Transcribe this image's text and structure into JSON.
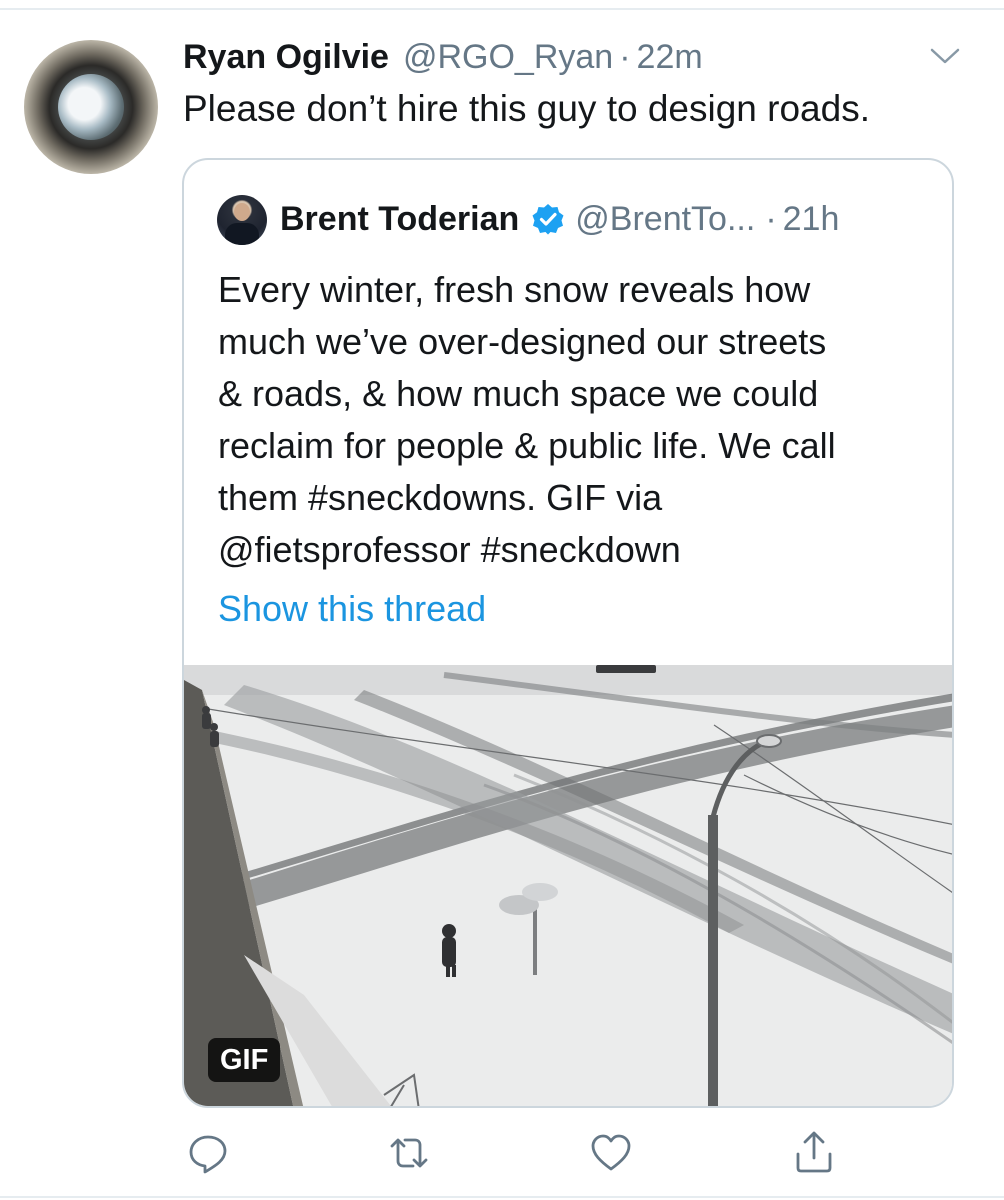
{
  "tweet": {
    "author_name": "Ryan Ogilvie",
    "author_handle": "@RGO_Ryan",
    "separator": "·",
    "time": "22m",
    "text": "Please don’t hire this guy to design roads."
  },
  "quoted_tweet": {
    "author_name": "Brent Toderian",
    "author_handle": "@BrentTo...",
    "separator": "·",
    "time": "21h",
    "text_lines": [
      "Every winter, fresh snow reveals how",
      "much we’ve over-designed our streets",
      "& roads, & how much space we could",
      "reclaim for people & public life. We call",
      "them #sneckdowns. GIF via",
      "@fietsprofessor #sneckdown"
    ],
    "show_thread_label": "Show this thread",
    "media_badge": "GIF"
  },
  "actions": [
    "reply-icon",
    "retweet-icon",
    "like-icon",
    "share-icon"
  ],
  "colors": {
    "link": "#1b95e0",
    "secondary_text": "#657786",
    "border": "#ccd6dd",
    "verified": "#1da1f2"
  }
}
